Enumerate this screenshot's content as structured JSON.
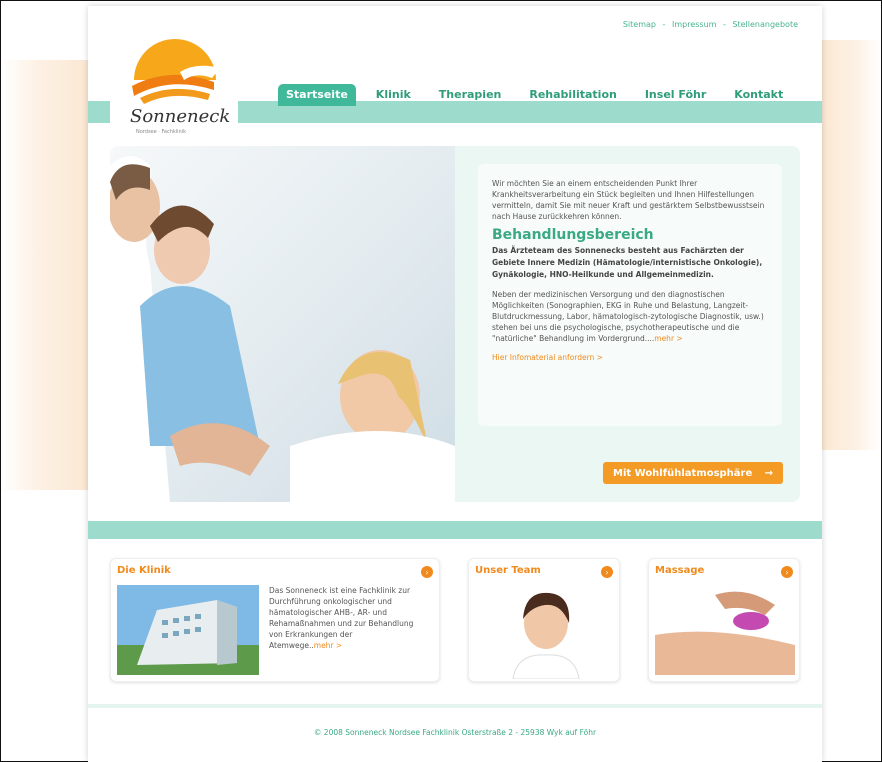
{
  "top_links": [
    "Sitemap",
    "Impressum",
    "Stellenangebote"
  ],
  "top_links_sep": "-",
  "logo": {
    "name": "Sonneneck",
    "sub": "Nordsee · Fachklinik"
  },
  "nav": [
    "Startseite",
    "Klinik",
    "Therapien",
    "Rehabilitation",
    "Insel Föhr",
    "Kontakt"
  ],
  "hero": {
    "intro": "Wir möchten Sie an einem entscheidenden Punkt Ihrer Krankheitsverarbeitung ein Stück begleiten und Ihnen Hilfestellungen vermitteln, damit Sie mit neuer Kraft und gestärktem Selbstbewusstsein nach Hause zurückkehren können.",
    "heading": "Behandlungsbereich",
    "strong": "Das Ärzteteam des Sonnenecks besteht aus Fachärzten der Gebiete Innere Medizin (Hämatologie/internistische Onkologie), Gynäkologie, HNO-Heilkunde und Allgemeinmedizin.",
    "body": "Neben der medizinischen Versorgung und den diagnostischen Möglichkeiten (Sonographien, EKG in Ruhe und Belastung, Langzeit-Blutdruckmessung, Labor, hämatologisch-zytologische Diagnostik, usw.) stehen bei uns die psychologische, psychotherapeutische und die \"natürliche\" Behandlung im Vordergrund....",
    "more": "mehr >",
    "info_link": "Hier Infomaterial anfordern >",
    "cta": "Mit Wohlfühlatmosphäre",
    "cta_arrow": "→"
  },
  "boxes": [
    {
      "title": "Die Klinik",
      "text": "Das Sonneneck ist eine Fachklinik zur Durchführung onkologischer und hämatologischer AHB-, AR- und Rehamaßnahmen und zur Behandlung von Erkrankungen der Atemwege..",
      "more": "mehr >"
    },
    {
      "title": "Unser Team"
    },
    {
      "title": "Massage"
    }
  ],
  "footer": "© 2008 Sonneneck Nordsee Fachklinik Osterstraße 2 - 25938 Wyk auf Föhr",
  "colors": {
    "accent_green": "#3aa984",
    "stripe": "#9ddccc",
    "orange": "#f08a1d"
  }
}
